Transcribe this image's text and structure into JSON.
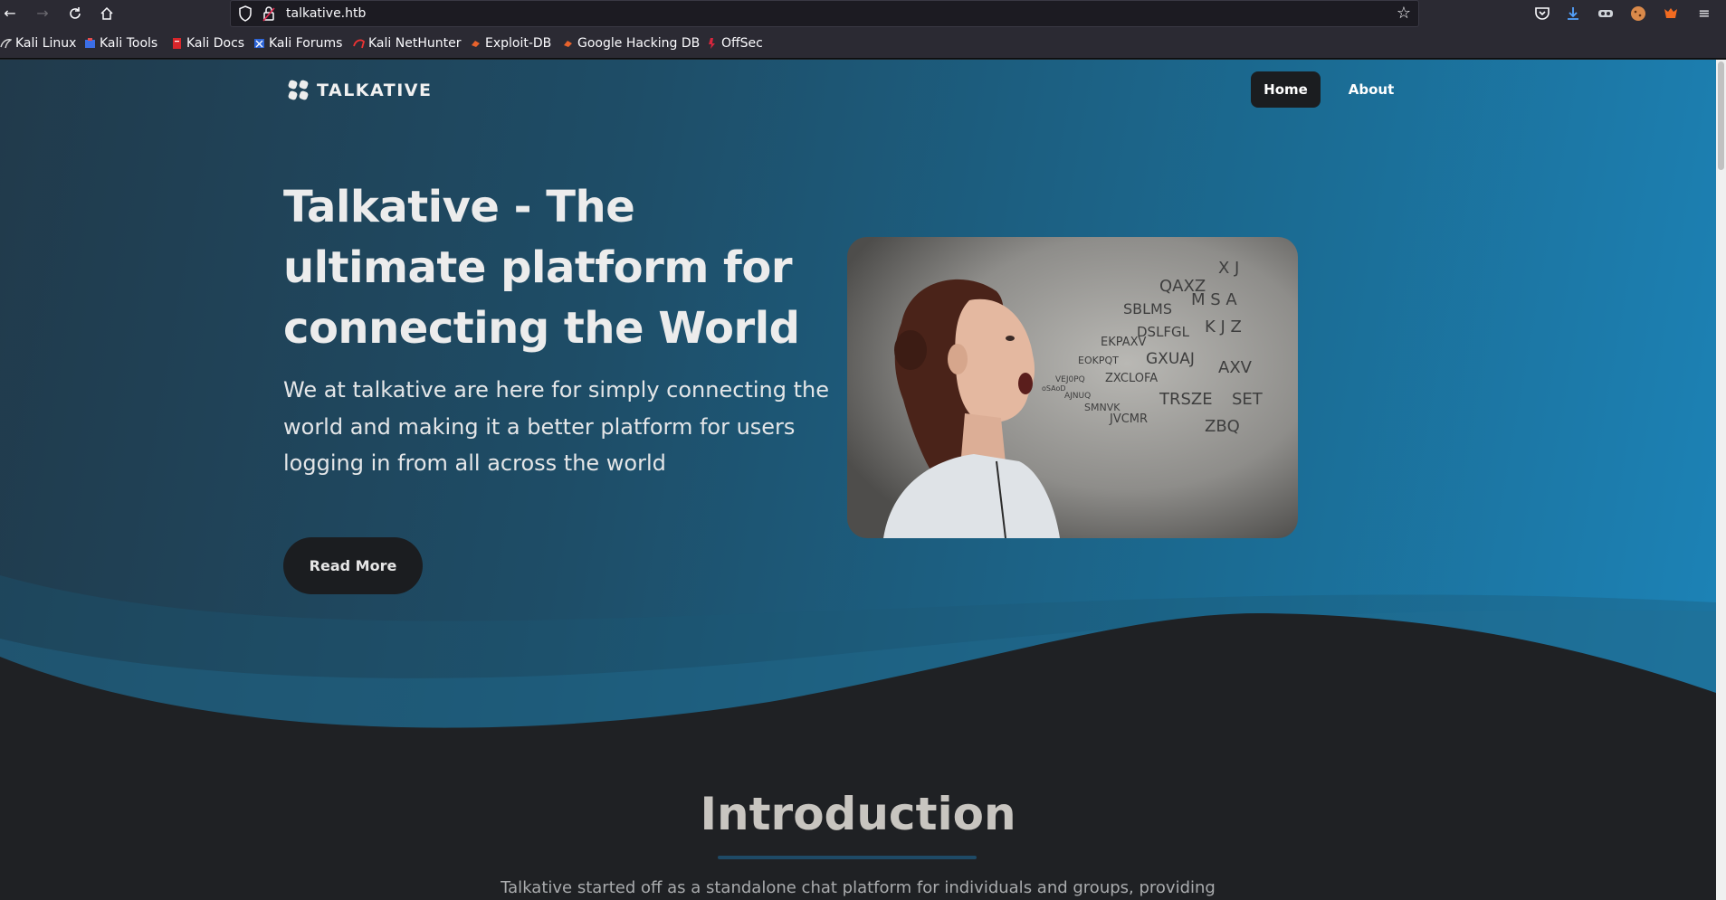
{
  "browser": {
    "url": "talkative.htb",
    "bookmarks": [
      {
        "label": "Kali Linux",
        "icon": "kali-dragon-icon"
      },
      {
        "label": "Kali Tools",
        "icon": "kali-tools-icon"
      },
      {
        "label": "Kali Docs",
        "icon": "kali-docs-icon"
      },
      {
        "label": "Kali Forums",
        "icon": "kali-forums-icon"
      },
      {
        "label": "Kali NetHunter",
        "icon": "nethunter-icon"
      },
      {
        "label": "Exploit-DB",
        "icon": "exploit-db-icon"
      },
      {
        "label": "Google Hacking DB",
        "icon": "ghdb-icon"
      },
      {
        "label": "OffSec",
        "icon": "offsec-icon"
      }
    ]
  },
  "site": {
    "brand": "TALKATIVE",
    "nav": {
      "home": "Home",
      "about": "About"
    },
    "hero": {
      "headline": "Talkative - The ultimate platform for connecting the World",
      "lead": "We at talkative are here for simply connecting the world and making it a better platform for users logging in from all across the world",
      "cta": "Read More"
    },
    "intro": {
      "title": "Introduction",
      "text": "Talkative started off as a standalone chat platform for individuals and groups, providing"
    }
  },
  "colors": {
    "hero_start": "#213a4b",
    "hero_end": "#1c83b7",
    "dark_bg": "#1f2124",
    "button_bg": "#1b1d20"
  }
}
